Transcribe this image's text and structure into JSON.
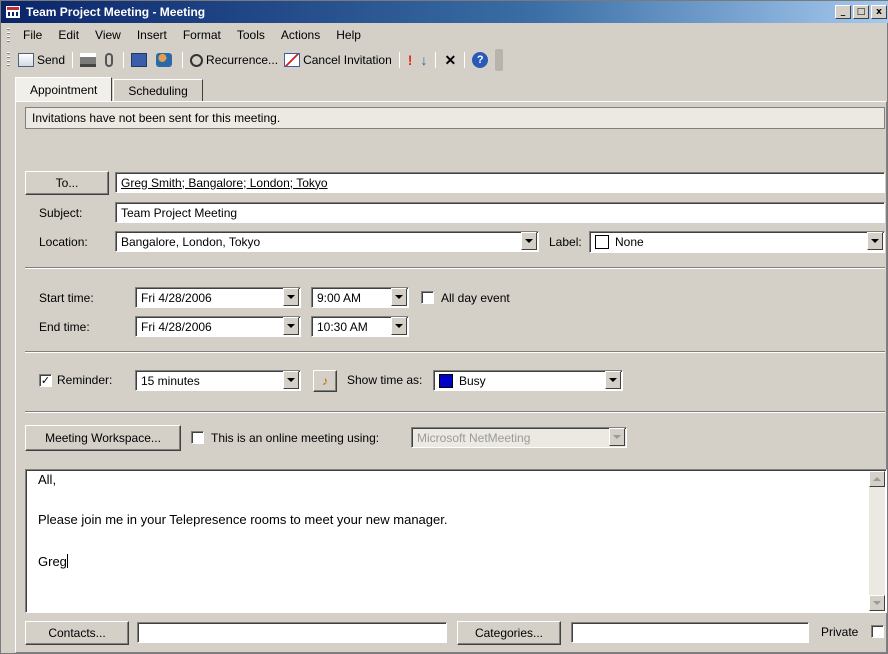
{
  "window": {
    "title": "Team Project Meeting - Meeting",
    "controls": {
      "minimize": "_",
      "maximize": "□",
      "close": "x"
    }
  },
  "menu": [
    "File",
    "Edit",
    "View",
    "Insert",
    "Format",
    "Tools",
    "Actions",
    "Help"
  ],
  "toolbar": {
    "send_label": "Send",
    "recurrence_label": "Recurrence...",
    "cancel_invitation_label": "Cancel Invitation",
    "importance_high": "!",
    "importance_low": "↓",
    "delete": "✕",
    "help": "?"
  },
  "tabs": [
    {
      "label": "Appointment",
      "active": true
    },
    {
      "label": "Scheduling",
      "active": false
    }
  ],
  "info_message": "Invitations have not been sent for this meeting.",
  "to": {
    "button": "To...",
    "value": "Greg Smith; Bangalore; London; Tokyo"
  },
  "subject": {
    "label": "Subject:",
    "value": "Team Project Meeting"
  },
  "location": {
    "label": "Location:",
    "value": "Bangalore, London, Tokyo"
  },
  "label_field": {
    "label": "Label:",
    "value": "None"
  },
  "start": {
    "label": "Start time:",
    "date": "Fri 4/28/2006",
    "time": "9:00 AM"
  },
  "end": {
    "label": "End time:",
    "date": "Fri 4/28/2006",
    "time": "10:30 AM"
  },
  "all_day": {
    "label": "All day event",
    "checked": false
  },
  "reminder": {
    "label": "Reminder:",
    "checked": true,
    "value": "15 minutes"
  },
  "show_time_as": {
    "label": "Show time as:",
    "value": "Busy",
    "color": "#0000c8"
  },
  "workspace": {
    "button": "Meeting Workspace...",
    "online_label": "This is an online meeting using:",
    "online_checked": false,
    "online_value": "Microsoft NetMeeting"
  },
  "message_body": [
    "All,",
    "Please join me in your Telepresence rooms to meet your new manager.",
    "Greg"
  ],
  "footer": {
    "contacts_button": "Contacts...",
    "contacts_value": "",
    "categories_button": "Categories...",
    "categories_value": "",
    "private_label": "Private",
    "private_checked": false
  },
  "colors": {
    "title_bar": "#0a246a",
    "face": "#d4d0c8"
  }
}
